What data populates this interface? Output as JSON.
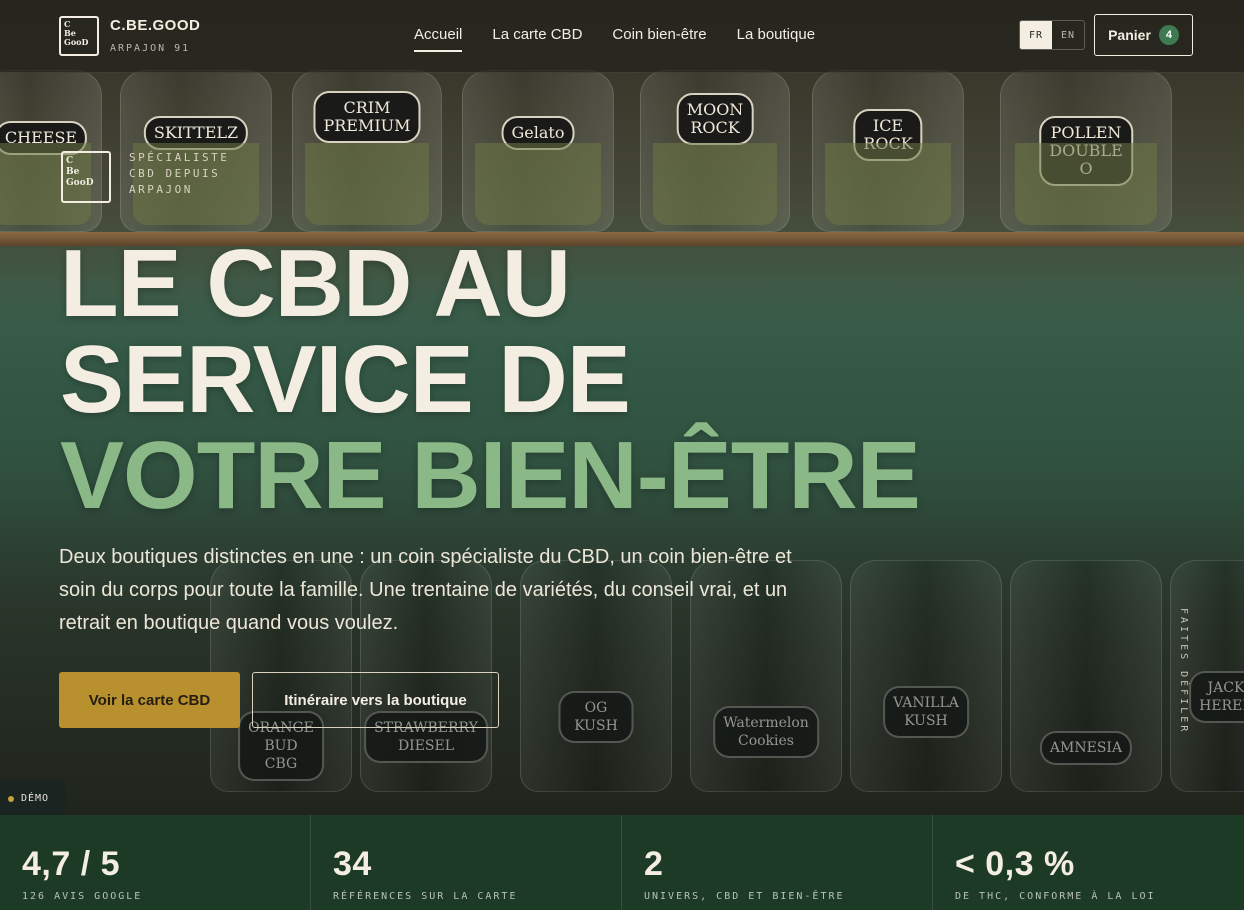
{
  "header": {
    "brand": "C.BE.GOOD",
    "brand_sub": "ARPAJON 91",
    "nav": [
      "Accueil",
      "La carte CBD",
      "Coin bien-être",
      "La boutique"
    ],
    "lang": [
      "FR",
      "EN"
    ],
    "cart_label": "Panier",
    "cart_count": "4"
  },
  "hero": {
    "stamp_text": "SPÉCIALISTE CBD DEPUIS ARPAJON",
    "headline": [
      "LE CBD AU",
      "SERVICE DE",
      "VOTRE BIEN-ÊTRE"
    ],
    "lead": "Deux boutiques distinctes en une : un coin spécialiste du CBD, un coin bien-être et soin du corps pour toute la famille. Une trentaine de variétés, du conseil vrai, et un retrait en boutique quand vous voulez.",
    "primary_cta": "Voir la carte CBD",
    "secondary_cta": "Itinéraire vers la boutique",
    "scroll_hint": "FAITES DÉFILER",
    "jar_labels_top": [
      "CHEESE",
      "SKITTELZ",
      "CRIM\nPREMIUM",
      "Gelato",
      "MOON\nROCK",
      "ICE\nROCK",
      "POLLEN\nDOUBLE O"
    ],
    "jar_labels_bottom": [
      "ORANGE\nBUD\nCBG",
      "STRAWBERRY\nDIESEL",
      "OG KUSH",
      "Watermelon\nCookies",
      "VANILLA\nKUSH",
      "AMNESIA",
      "JACK\nHERER"
    ]
  },
  "demo_badge": "DÉMO",
  "stats": [
    {
      "value": "4,7 / 5",
      "label": "126 AVIS GOOGLE"
    },
    {
      "value": "34",
      "label": "RÉFÉRENCES SUR LA CARTE"
    },
    {
      "value": "2",
      "label": "UNIVERS, CBD ET BIEN-ÊTRE"
    },
    {
      "value": "< 0,3 %",
      "label": "DE THC, CONFORME À LA LOI"
    }
  ]
}
